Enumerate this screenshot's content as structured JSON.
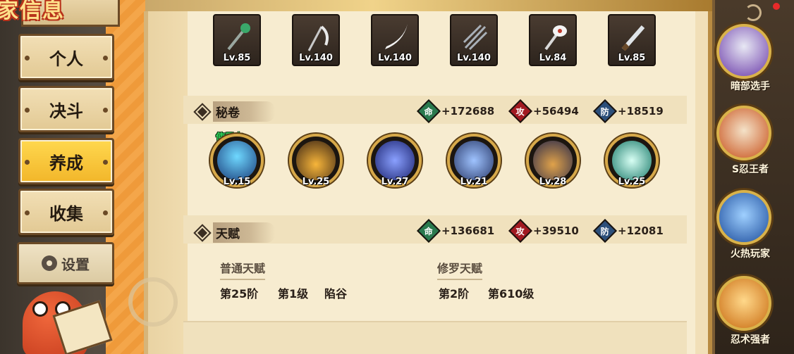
{
  "header": {
    "title": "家信息"
  },
  "nav": {
    "items": [
      {
        "label": "个人",
        "active": false
      },
      {
        "label": "决斗",
        "active": false
      },
      {
        "label": "养成",
        "active": true
      },
      {
        "label": "收集",
        "active": false
      }
    ],
    "settings_label": "设置"
  },
  "weapons": [
    {
      "icon": "staff-icon",
      "level": "Lv.85"
    },
    {
      "icon": "scythe-icon",
      "level": "Lv.140"
    },
    {
      "icon": "sword-icon",
      "level": "Lv.140"
    },
    {
      "icon": "claw-icon",
      "level": "Lv.140"
    },
    {
      "icon": "fan-icon",
      "level": "Lv.84"
    },
    {
      "icon": "blade-icon",
      "level": "Lv.85"
    }
  ],
  "scrolls_section": {
    "title": "秘卷",
    "stats": [
      {
        "badge": "命",
        "value": "+172688"
      },
      {
        "badge": "攻",
        "value": "+56494"
      },
      {
        "badge": "防",
        "value": "+18519"
      }
    ],
    "in_use_label": "使用中",
    "items": [
      {
        "level": "Lv.15"
      },
      {
        "level": "Lv.25"
      },
      {
        "level": "Lv.27"
      },
      {
        "level": "Lv.21"
      },
      {
        "level": "Lv.28"
      },
      {
        "level": "Lv.25"
      }
    ]
  },
  "talent_section": {
    "title": "天赋",
    "stats": [
      {
        "badge": "命",
        "value": "+136681"
      },
      {
        "badge": "攻",
        "value": "+39510"
      },
      {
        "badge": "防",
        "value": "+12081"
      }
    ],
    "normal": {
      "label": "普通天赋",
      "tier": "第25阶",
      "grade": "第1级",
      "place": "陷谷"
    },
    "asura": {
      "label": "修罗天赋",
      "tier": "第2阶",
      "grade": "第610级"
    }
  },
  "badges": [
    {
      "label": "暗部选手",
      "icon": "anbu-mask-icon"
    },
    {
      "label": "S忍王者",
      "icon": "sage-portrait-icon"
    },
    {
      "label": "火热玩家",
      "icon": "hot-player-icon"
    },
    {
      "label": "忍术强者",
      "icon": "ninjutsu-master-icon"
    }
  ],
  "colors": {
    "parchment": "#f7ecd0",
    "gold": "#d7a94a",
    "life": "#2a7a4e",
    "attack": "#a21a22",
    "defense": "#2c4f7a",
    "in_use": "#2fd15a"
  }
}
